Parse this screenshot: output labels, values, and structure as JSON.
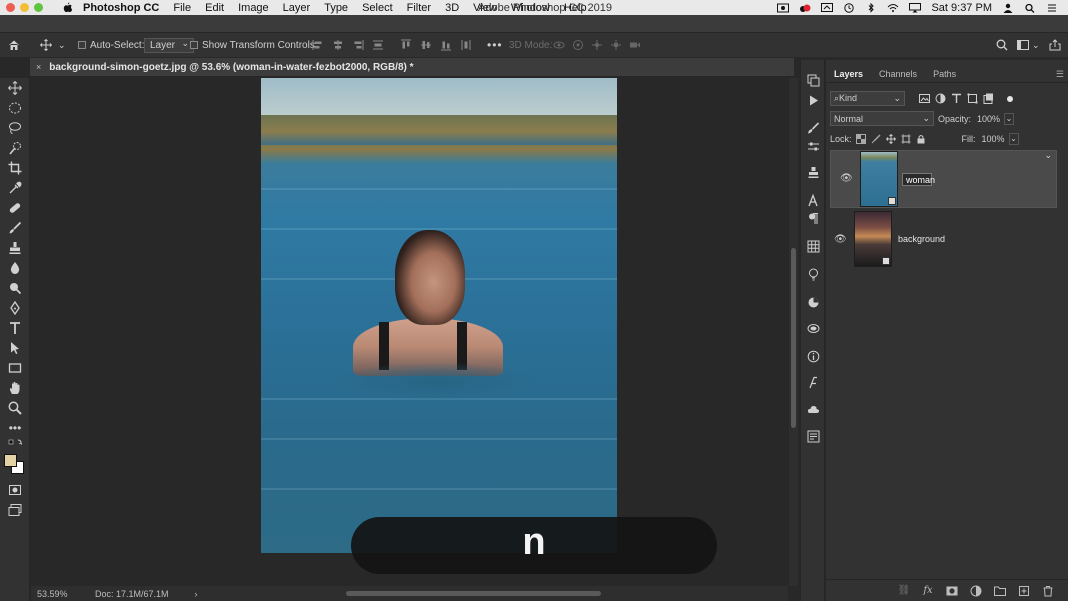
{
  "menubar": {
    "app_name": "Photoshop CC",
    "items": [
      "File",
      "Edit",
      "Image",
      "Layer",
      "Type",
      "Select",
      "Filter",
      "3D",
      "View",
      "Window",
      "Help"
    ],
    "window_title": "Adobe Photoshop CC 2019",
    "clock": "Sat 9:37 PM"
  },
  "options_bar": {
    "auto_select_label": "Auto-Select:",
    "auto_select_value": "Layer",
    "show_transform_label": "Show Transform Controls",
    "mode_3d_label": "3D Mode:"
  },
  "document": {
    "tab_title": "background-simon-goetz.jpg @ 53.6% (woman-in-water-fezbot2000, RGB/8) *",
    "close_symbol": "×"
  },
  "status_bar": {
    "zoom": "53.59%",
    "doc_size": "Doc: 17.1M/67.1M",
    "arrow": "›"
  },
  "key_overlay": {
    "key": "n"
  },
  "layers_panel": {
    "tabs": [
      "Layers",
      "Channels",
      "Paths"
    ],
    "filter_kind": "Kind",
    "blend_mode": "Normal",
    "opacity_label": "Opacity:",
    "opacity_value": "100%",
    "lock_label": "Lock:",
    "fill_label": "Fill:",
    "fill_value": "100%",
    "layers": [
      {
        "name": "woman",
        "editing": true
      },
      {
        "name": "background",
        "editing": false
      }
    ],
    "bottom_fx": "fx"
  },
  "colors": {
    "foreground": "#e4d3a6",
    "background": "#ffffff"
  }
}
